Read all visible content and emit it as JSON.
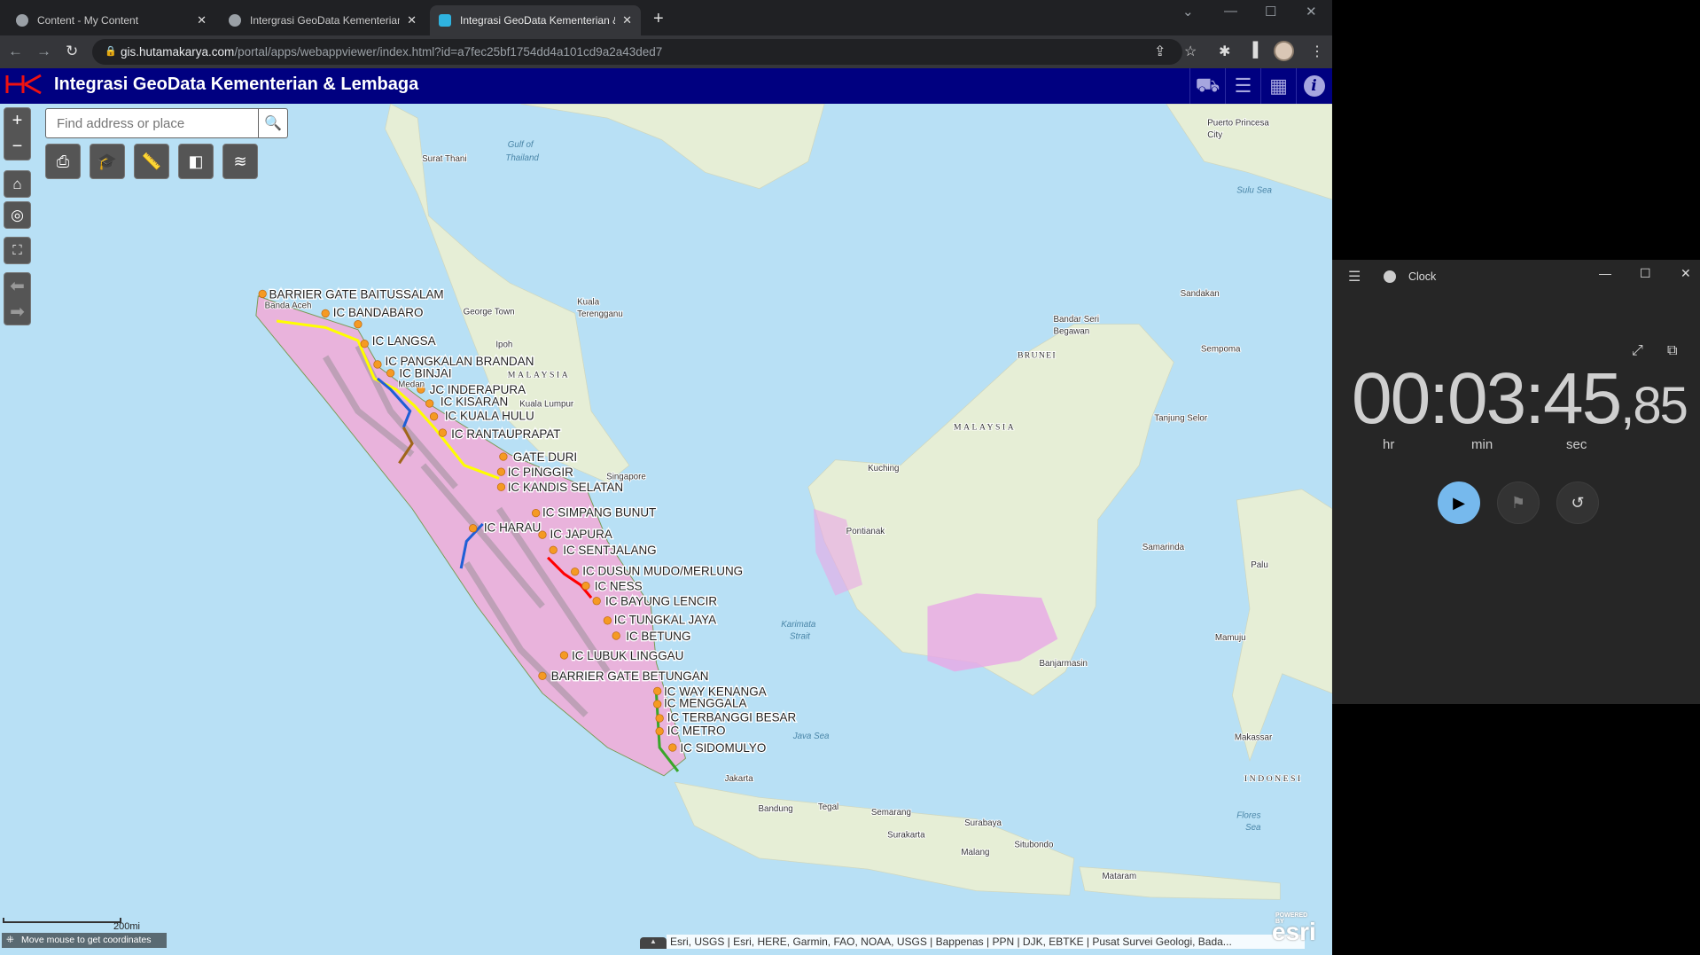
{
  "browser": {
    "tabs": [
      {
        "label": "Content - My Content",
        "active": false
      },
      {
        "label": "Intergrasi GeoData Kementerian & Lembaga",
        "active": false
      },
      {
        "label": "Integrasi GeoData Kementerian & Lembaga",
        "active": true
      }
    ],
    "new_tab": "+",
    "url_host": "gis.hutamakarya.com",
    "url_path": "/portal/apps/webappviewer/index.html?id=a7fec25bf1754dd4a101cd9a2a43ded7"
  },
  "app": {
    "title": "Integrasi GeoData Kementerian & Lembaga",
    "header_buttons": [
      "add-data",
      "legend",
      "basemap-gallery",
      "about"
    ],
    "search": {
      "placeholder": "Find address or place"
    },
    "tools": [
      "print",
      "layer-list-edu",
      "measurement",
      "swipe",
      "layers"
    ],
    "scale": "200mi",
    "coords_text": "Move mouse to get coordinates",
    "attribution": "Esri, USGS | Esri, HERE, Garmin, FAO, NOAA, USGS | Bappenas | PPN | DJK, EBTKE | Pusat Survei Geologi, Bada...",
    "esri_powered": "POWERED BY",
    "esri_logo": "esri",
    "colors": {
      "header": "#000080",
      "route_yellow": "#ffff00",
      "route_blue": "#1f5fd6",
      "route_red": "#ff0000",
      "route_green": "#3aa62a",
      "marker": "#f59a23"
    }
  },
  "map": {
    "toll_labels": [
      "BARRIER GATE BAITUSSALAM",
      "IC BANDABARO",
      "IC LANGSA",
      "IC PANGKALAN BRANDAN",
      "IC BINJAI",
      "JC INDERAPURA",
      "IC KISARAN",
      "IC KUALA HULU",
      "IC RANTAUPRAPAT",
      "GATE DURI",
      "IC PINGGIR",
      "IC KANDIS SELATAN",
      "IC SIMPANG BUNUT",
      "IC HARAU",
      "IC JAPURA",
      "IC SENTJALANG",
      "IC DUSUN MUDO/MERLUNG",
      "IC NESS",
      "IC BAYUNG LENCIR",
      "IC TUNGKAL JAYA",
      "IC BETUNG",
      "IC LUBUK LINGGAU",
      "BARRIER GATE BETUNGAN",
      "IC WAY KENANGA",
      "IC MENGGALA",
      "IC TERBANGGI BESAR",
      "IC METRO",
      "IC SIDOMULYO"
    ],
    "places": [
      "Surat Thani",
      "Gulf of",
      "Thailand",
      "George Town",
      "Kuala",
      "Terengganu",
      "Ipoh",
      "MALAYSIA",
      "Kuala Lumpur",
      "Singapore",
      "Medan",
      "Banda Aceh",
      "Puerto Princesa",
      "City",
      "Sulu Sea",
      "Sandakan",
      "Bandar Seri",
      "Begawan",
      "BRUNEI",
      "Sempoma",
      "MALAYSIA",
      "Tanjung Selor",
      "Kuching",
      "Samarinda",
      "Karimata",
      "Strait",
      "Java Sea",
      "Jakarta",
      "Bandung",
      "Tegal",
      "Semarang",
      "Surakarta",
      "Surabaya",
      "Malang",
      "Situbondo",
      "Mataram",
      "INDONESI",
      "Flores",
      "Sea",
      "Banjarmasin",
      "Makassar",
      "Mamuju",
      "Palu",
      "Pontianak"
    ]
  },
  "clock": {
    "title": "Clock",
    "time_main": "00:03:45",
    "time_frac": ",85",
    "units": [
      "hr",
      "min",
      "sec"
    ]
  }
}
